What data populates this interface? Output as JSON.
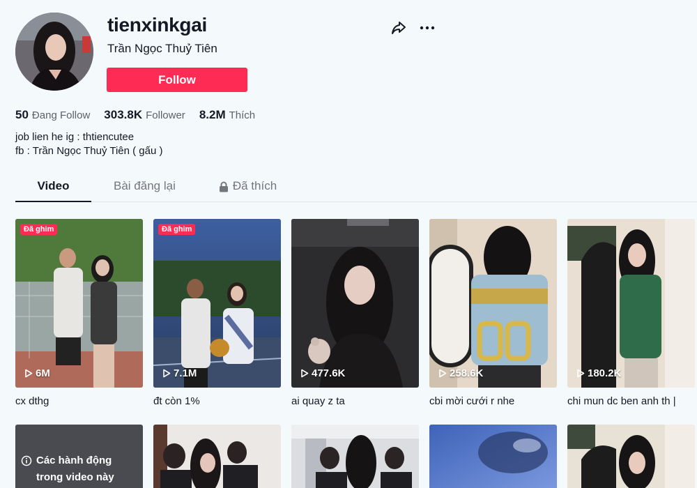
{
  "profile": {
    "username": "tienxinkgai",
    "nickname": "Trần Ngọc Thuỷ Tiên",
    "follow_label": "Follow"
  },
  "stats": {
    "following_count": "50",
    "following_label": "Đang Follow",
    "follower_count": "303.8K",
    "follower_label": "Follower",
    "likes_count": "8.2M",
    "likes_label": "Thích"
  },
  "bio": {
    "line1": "job lien he ig : thtiencutee",
    "line2": "fb : Trần Ngọc Thuỷ Tiên ( gấu )"
  },
  "tabs": [
    {
      "label": "Video",
      "active": true
    },
    {
      "label": "Bài đăng lại",
      "active": false
    },
    {
      "label": "Đã thích",
      "active": false,
      "locked": true
    }
  ],
  "videos": [
    {
      "pinned": "Đã ghim",
      "views": "6M",
      "caption": "cx dthg"
    },
    {
      "pinned": "Đã ghim",
      "views": "7.1M",
      "caption": "đt còn 1%"
    },
    {
      "views": "477.6K",
      "caption": "ai quay z ta"
    },
    {
      "views": "258.6K",
      "caption": "cbi mời cưới r nhe"
    },
    {
      "views": "180.2K",
      "caption": "chi mun dc ben anh th |"
    }
  ],
  "videos_row2": [
    {
      "warning": "Các hành động trong video này"
    }
  ],
  "colors": {
    "accent": "#fe2c55",
    "background": "#f4f9fc",
    "text": "#161823"
  }
}
